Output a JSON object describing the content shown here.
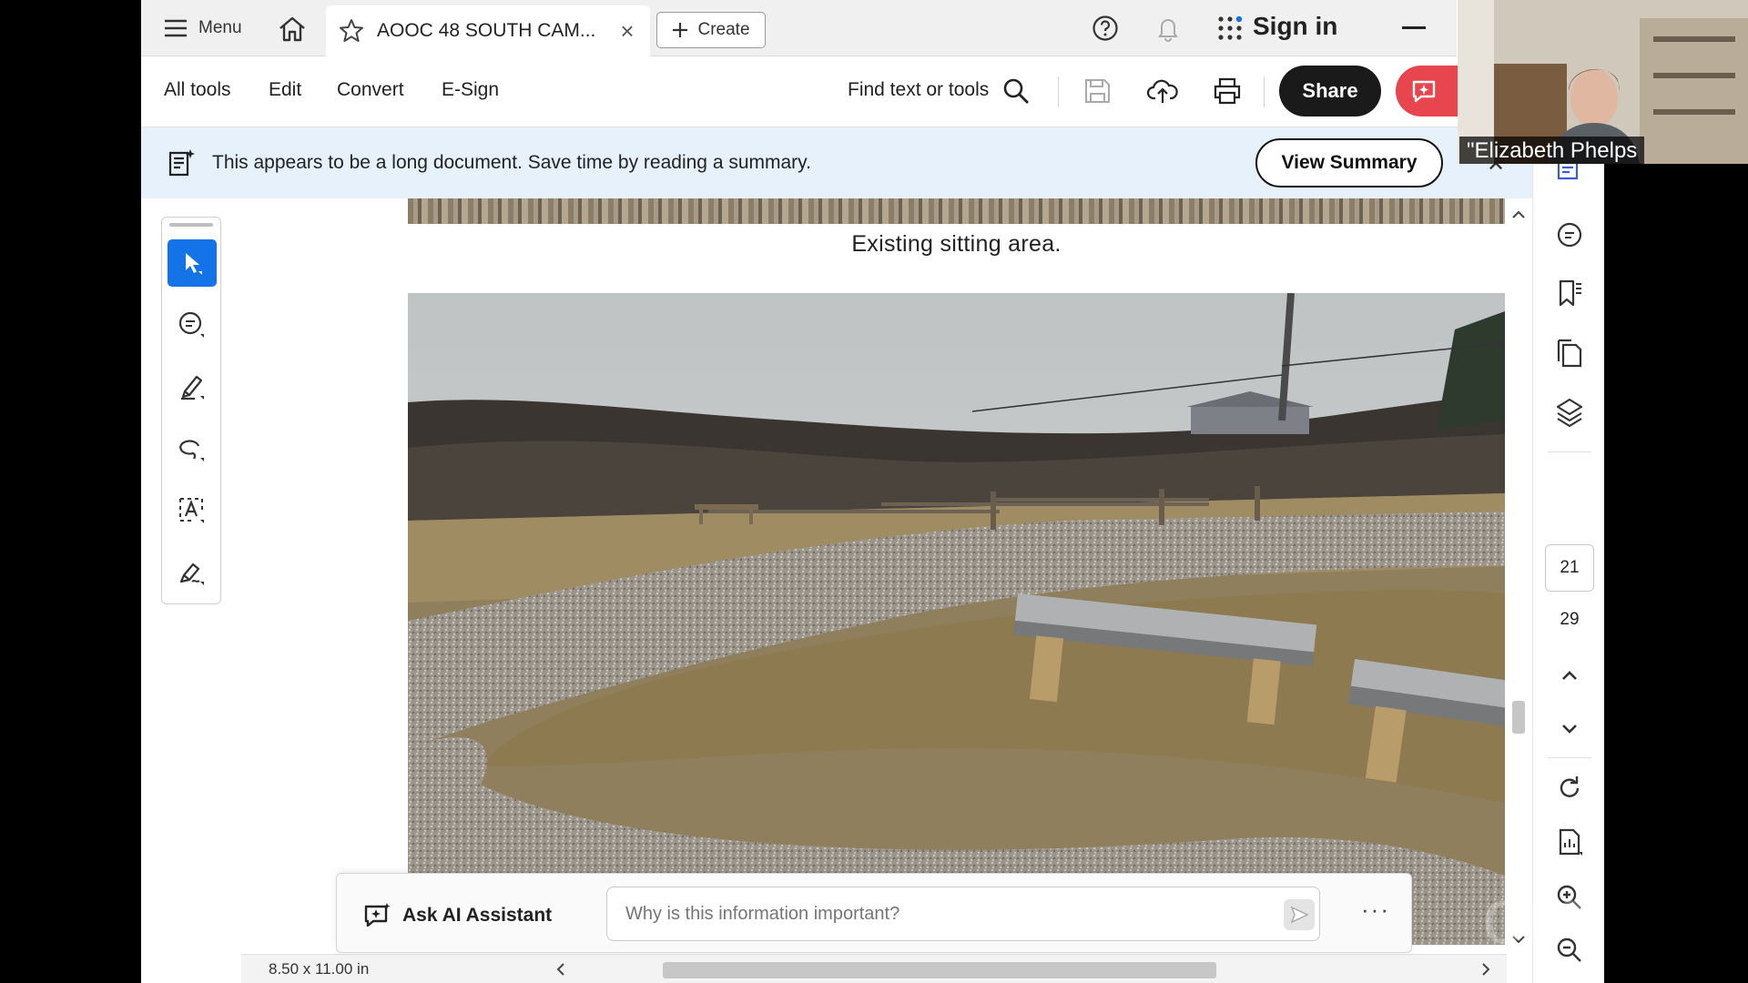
{
  "tabbar": {
    "menu_label": "Menu",
    "tab_title": "AOOC 48 SOUTH CAM...",
    "create_label": "Create",
    "signin_label": "Sign in"
  },
  "toolbar": {
    "all_tools": "All tools",
    "edit": "Edit",
    "convert": "Convert",
    "esign": "E-Sign",
    "find_label": "Find text or tools",
    "share_label": "Share"
  },
  "banner": {
    "message": "This appears to be a long document. Save time by reading a summary.",
    "button_label": "View Summary"
  },
  "document": {
    "caption": "Existing sitting area.",
    "page_size": "8.50 x 11.00 in"
  },
  "ai_assistant": {
    "label": "Ask AI Assistant",
    "placeholder": "Why is this information important?",
    "more": "···"
  },
  "page_nav": {
    "current": "21",
    "total": "29"
  },
  "webcam": {
    "participant_name": "\"Elizabeth Phelps"
  },
  "colors": {
    "accent_blue": "#1473e6",
    "banner_bg": "#e6f1fc",
    "share_bg": "#1a1a1a",
    "ai_red": "#e8464e"
  }
}
